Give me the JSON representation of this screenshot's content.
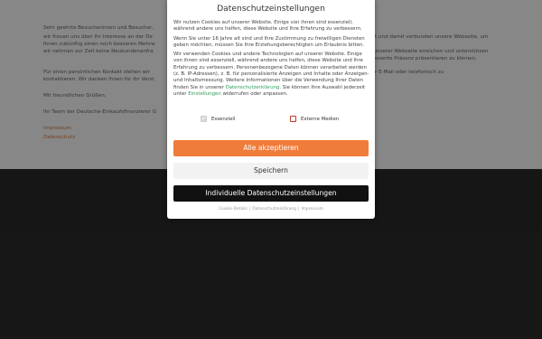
{
  "background": {
    "lines": [
      "Sehr geehrte Besucherinnen und Besucher,",
      "wir freuen uns über Ihr Interesse an der De",
      "Ihnen zukünftig einen noch besseren Mehrw",
      "wir nehmen zur Zeit keine Neukundenanfra",
      "Für einen persönlichen Kontakt stehen wir",
      "kontaktieren. Wir danken Ihnen für Ihr Verst",
      "Mit freundlichen Grüßen,",
      "Ihr Team der Deutsche-Einkaufsfinanzierer G"
    ],
    "right_lines": [
      "mit und damit verbunden unsere Webseite, um",
      "n unserer Webseite erreichen und unterstützen",
      "rbesserte Präsenz präsentieren zu können.",
      "per E-Mail oder telefonisch zu"
    ],
    "links": [
      "Impressum",
      "Datenschutz"
    ]
  },
  "modal": {
    "title": "Datenschutzeinstellungen",
    "paragraph1": "Wir nutzen Cookies auf unserer Website. Einige von ihnen sind essenziell, während andere uns helfen, diese Website und Ihre Erfahrung zu verbessern.",
    "paragraph2": "Wenn Sie unter 16 Jahre alt sind und Ihre Zustimmung zu freiwilligen Diensten geben möchten, müssen Sie Ihre Erziehungsberechtigten um Erlaubnis bitten.",
    "paragraph3_part1": "Wir verwenden Cookies und andere Technologien auf unserer Website. Einige von ihnen sind essenziell, während andere uns helfen, diese Website und Ihre Erfahrung zu verbessern. Personenbezogene Daten können verarbeitet werden (z. B. IP-Adressen), z. B. für personalisierte Anzeigen und Inhalte oder Anzeigen- und Inhaltsmessung. Weitere Informationen über die Verwendung Ihrer Daten finden Sie in unserer",
    "paragraph3_link1": "Datenschutzerklärung",
    "paragraph3_part2": ". Sie können Ihre Auswahl jederzeit unter",
    "paragraph3_link2": "Einstellungen",
    "paragraph3_part3": "widerrufen oder anpassen.",
    "checkboxes": [
      {
        "label": "Essenziell",
        "checked": true,
        "disabled": true
      },
      {
        "label": "Externe Medien",
        "checked": false,
        "disabled": false
      }
    ],
    "buttons": {
      "accept_all": "Alle akzeptieren",
      "save": "Speichern",
      "individual": "Individuelle Datenschutzeinstellungen"
    },
    "footer_links": [
      "Cookie-Details",
      "Datenschutzerklärung",
      "Impressum"
    ],
    "colors": {
      "accent": "#f07c3a",
      "link": "#2e9e5a",
      "dark_button": "#111111"
    }
  }
}
